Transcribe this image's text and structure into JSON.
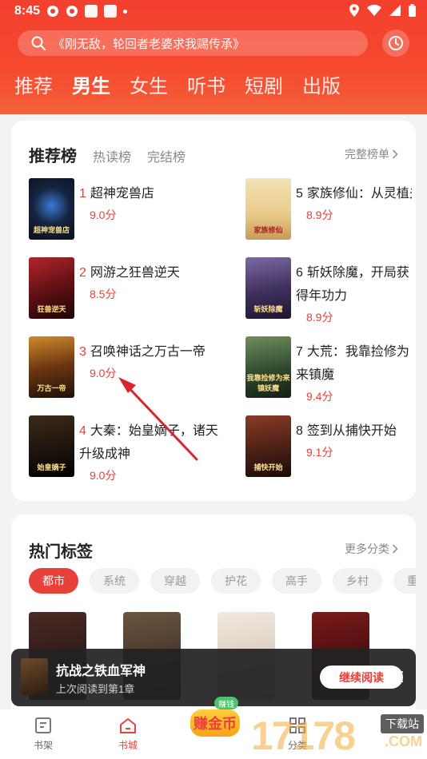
{
  "status": {
    "time": "8:45"
  },
  "search": {
    "placeholder": "《刚无敌，轮回者老婆求我赐传承》"
  },
  "tabs": [
    {
      "label": "推荐",
      "active": false
    },
    {
      "label": "男生",
      "active": true
    },
    {
      "label": "女生",
      "active": false
    },
    {
      "label": "听书",
      "active": false
    },
    {
      "label": "短剧",
      "active": false
    },
    {
      "label": "出版",
      "active": false
    }
  ],
  "ranking": {
    "title": "推荐榜",
    "subtabs": [
      "热读榜",
      "完结榜"
    ],
    "more": "完整榜单",
    "books": [
      {
        "rank": "1",
        "title": "超神宠兽店",
        "score": "9.0分",
        "cover_text": "超神宠兽店"
      },
      {
        "rank": "2",
        "title": "网游之狂兽逆天",
        "score": "8.5分",
        "cover_text": "狂兽逆天"
      },
      {
        "rank": "3",
        "title": "召唤神话之万古一帝",
        "score": "9.0分",
        "cover_text": "万古一帝"
      },
      {
        "rank": "4",
        "title": "大秦：始皇嫡子，诸天升级成神",
        "score": "9.0分",
        "cover_text": "始皇嫡子"
      },
      {
        "rank": "5",
        "title": "家族修仙：从灵植夫",
        "score": "8.9分",
        "cover_text": "家族修仙"
      },
      {
        "rank": "6",
        "title": "斩妖除魔，开局获得年功力",
        "score": "8.9分",
        "cover_text": "斩妖除魔"
      },
      {
        "rank": "7",
        "title": "大荒：我靠捡修为来镇魔",
        "score": "9.4分",
        "cover_text": "我靠捡修为来镇妖魔"
      },
      {
        "rank": "8",
        "title": "签到从捕快开始",
        "score": "9.1分",
        "cover_text": "捕快开始"
      }
    ]
  },
  "tags": {
    "title": "热门标签",
    "more": "更多分类",
    "chips": [
      "都市",
      "系统",
      "穿越",
      "护花",
      "高手",
      "乡村",
      "重生"
    ],
    "active": "都市"
  },
  "continue_reading": {
    "title": "抗战之铁血军神",
    "subtitle": "上次阅读到第1章",
    "button": "继续阅读"
  },
  "bottom_nav": {
    "shelf": "书架",
    "store": "书城",
    "earn": "赚金币",
    "earn_tag": "赚钱",
    "category": "分类"
  },
  "watermark": {
    "number": "17178",
    "download": "下载站",
    "domain": ".COM"
  },
  "colors": {
    "accent": "#e8413a",
    "header": "#f3402e"
  }
}
